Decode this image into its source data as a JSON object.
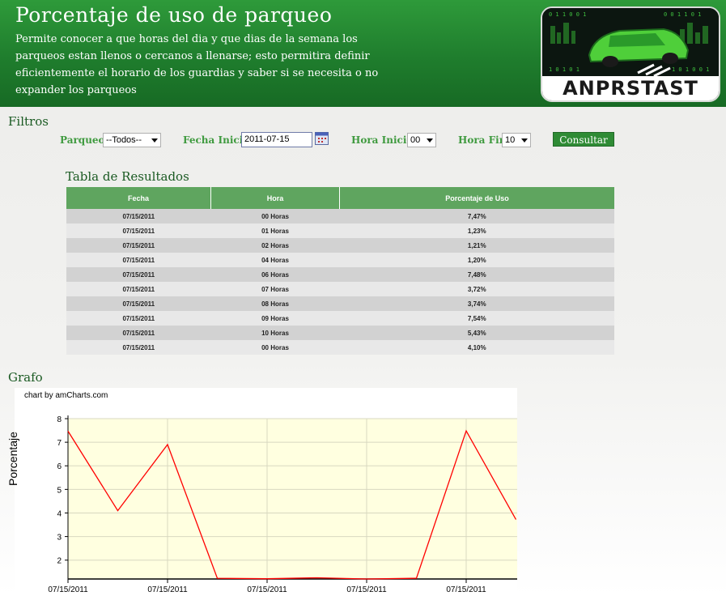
{
  "header": {
    "title": "Porcentaje de uso de parqueo",
    "description": "Permite conocer a que horas del dia y que dias de la semana los parqueos estan llenos o cercanos a llenarse; esto permitira definir eficientemente el horario de los guardias y saber si se necesita o no expander los parqueos",
    "logo_text": "ANPRSTAST"
  },
  "filters": {
    "heading": "Filtros",
    "parqueo_label": "Parqueo:",
    "parqueo_value": "--Todos--",
    "fecha_inicio_label": "Fecha Inicio:",
    "fecha_inicio_value": "2011-07-15",
    "hora_inicio_label": "Hora Inicio:",
    "hora_inicio_value": "00",
    "hora_fin_label": "Hora Fin:",
    "hora_fin_value": "10",
    "consultar_label": "Consultar"
  },
  "table": {
    "heading": "Tabla de Resultados",
    "columns": [
      "Fecha",
      "Hora",
      "Porcentaje de Uso"
    ],
    "rows": [
      [
        "07/15/2011",
        "00 Horas",
        "7,47%"
      ],
      [
        "07/15/2011",
        "01 Horas",
        "1,23%"
      ],
      [
        "07/15/2011",
        "02 Horas",
        "1,21%"
      ],
      [
        "07/15/2011",
        "04 Horas",
        "1,20%"
      ],
      [
        "07/15/2011",
        "06 Horas",
        "7,48%"
      ],
      [
        "07/15/2011",
        "07 Horas",
        "3,72%"
      ],
      [
        "07/15/2011",
        "08 Horas",
        "3,74%"
      ],
      [
        "07/15/2011",
        "09 Horas",
        "7,54%"
      ],
      [
        "07/15/2011",
        "10 Horas",
        "5,43%"
      ],
      [
        "07/15/2011",
        "00 Horas",
        "4,10%"
      ]
    ]
  },
  "grafo": {
    "heading": "Grafo",
    "credit": "chart by amCharts.com"
  },
  "chart_data": {
    "type": "line",
    "title": "",
    "xlabel": "",
    "ylabel": "Porcentaje",
    "ylim": [
      1.2,
      8
    ],
    "yticks": [
      2,
      3,
      4,
      5,
      6,
      7,
      8
    ],
    "x_tick_labels": [
      "07/15/2011",
      "07/15/2011",
      "07/15/2011",
      "07/15/2011",
      "07/15/2011"
    ],
    "values": [
      7.47,
      4.1,
      6.9,
      1.23,
      1.21,
      1.25,
      1.2,
      1.23,
      7.48,
      3.72
    ],
    "grid": true,
    "line_color": "#ff0000",
    "plot_background": "#ffffe0"
  },
  "colors": {
    "header_green": "#1f7d2d",
    "label_green": "#3f9a3f",
    "table_header": "#5fa55f",
    "row_dark": "#d2d2d2",
    "row_light": "#e8e8e8"
  }
}
